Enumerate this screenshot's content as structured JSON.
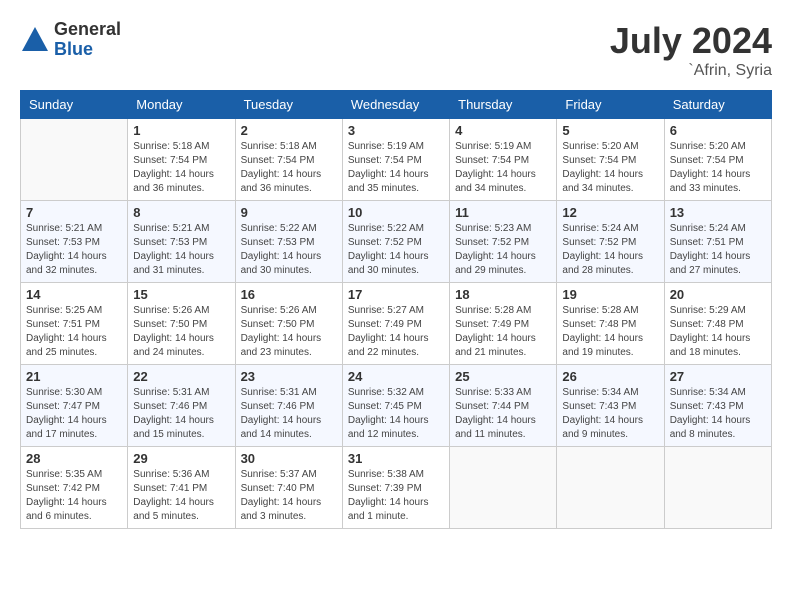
{
  "header": {
    "logo_general": "General",
    "logo_blue": "Blue",
    "month_year": "July 2024",
    "location": "`Afrin, Syria"
  },
  "days_of_week": [
    "Sunday",
    "Monday",
    "Tuesday",
    "Wednesday",
    "Thursday",
    "Friday",
    "Saturday"
  ],
  "weeks": [
    [
      {
        "day": "",
        "info": ""
      },
      {
        "day": "1",
        "info": "Sunrise: 5:18 AM\nSunset: 7:54 PM\nDaylight: 14 hours\nand 36 minutes."
      },
      {
        "day": "2",
        "info": "Sunrise: 5:18 AM\nSunset: 7:54 PM\nDaylight: 14 hours\nand 36 minutes."
      },
      {
        "day": "3",
        "info": "Sunrise: 5:19 AM\nSunset: 7:54 PM\nDaylight: 14 hours\nand 35 minutes."
      },
      {
        "day": "4",
        "info": "Sunrise: 5:19 AM\nSunset: 7:54 PM\nDaylight: 14 hours\nand 34 minutes."
      },
      {
        "day": "5",
        "info": "Sunrise: 5:20 AM\nSunset: 7:54 PM\nDaylight: 14 hours\nand 34 minutes."
      },
      {
        "day": "6",
        "info": "Sunrise: 5:20 AM\nSunset: 7:54 PM\nDaylight: 14 hours\nand 33 minutes."
      }
    ],
    [
      {
        "day": "7",
        "info": "Sunrise: 5:21 AM\nSunset: 7:53 PM\nDaylight: 14 hours\nand 32 minutes."
      },
      {
        "day": "8",
        "info": "Sunrise: 5:21 AM\nSunset: 7:53 PM\nDaylight: 14 hours\nand 31 minutes."
      },
      {
        "day": "9",
        "info": "Sunrise: 5:22 AM\nSunset: 7:53 PM\nDaylight: 14 hours\nand 30 minutes."
      },
      {
        "day": "10",
        "info": "Sunrise: 5:22 AM\nSunset: 7:52 PM\nDaylight: 14 hours\nand 30 minutes."
      },
      {
        "day": "11",
        "info": "Sunrise: 5:23 AM\nSunset: 7:52 PM\nDaylight: 14 hours\nand 29 minutes."
      },
      {
        "day": "12",
        "info": "Sunrise: 5:24 AM\nSunset: 7:52 PM\nDaylight: 14 hours\nand 28 minutes."
      },
      {
        "day": "13",
        "info": "Sunrise: 5:24 AM\nSunset: 7:51 PM\nDaylight: 14 hours\nand 27 minutes."
      }
    ],
    [
      {
        "day": "14",
        "info": "Sunrise: 5:25 AM\nSunset: 7:51 PM\nDaylight: 14 hours\nand 25 minutes."
      },
      {
        "day": "15",
        "info": "Sunrise: 5:26 AM\nSunset: 7:50 PM\nDaylight: 14 hours\nand 24 minutes."
      },
      {
        "day": "16",
        "info": "Sunrise: 5:26 AM\nSunset: 7:50 PM\nDaylight: 14 hours\nand 23 minutes."
      },
      {
        "day": "17",
        "info": "Sunrise: 5:27 AM\nSunset: 7:49 PM\nDaylight: 14 hours\nand 22 minutes."
      },
      {
        "day": "18",
        "info": "Sunrise: 5:28 AM\nSunset: 7:49 PM\nDaylight: 14 hours\nand 21 minutes."
      },
      {
        "day": "19",
        "info": "Sunrise: 5:28 AM\nSunset: 7:48 PM\nDaylight: 14 hours\nand 19 minutes."
      },
      {
        "day": "20",
        "info": "Sunrise: 5:29 AM\nSunset: 7:48 PM\nDaylight: 14 hours\nand 18 minutes."
      }
    ],
    [
      {
        "day": "21",
        "info": "Sunrise: 5:30 AM\nSunset: 7:47 PM\nDaylight: 14 hours\nand 17 minutes."
      },
      {
        "day": "22",
        "info": "Sunrise: 5:31 AM\nSunset: 7:46 PM\nDaylight: 14 hours\nand 15 minutes."
      },
      {
        "day": "23",
        "info": "Sunrise: 5:31 AM\nSunset: 7:46 PM\nDaylight: 14 hours\nand 14 minutes."
      },
      {
        "day": "24",
        "info": "Sunrise: 5:32 AM\nSunset: 7:45 PM\nDaylight: 14 hours\nand 12 minutes."
      },
      {
        "day": "25",
        "info": "Sunrise: 5:33 AM\nSunset: 7:44 PM\nDaylight: 14 hours\nand 11 minutes."
      },
      {
        "day": "26",
        "info": "Sunrise: 5:34 AM\nSunset: 7:43 PM\nDaylight: 14 hours\nand 9 minutes."
      },
      {
        "day": "27",
        "info": "Sunrise: 5:34 AM\nSunset: 7:43 PM\nDaylight: 14 hours\nand 8 minutes."
      }
    ],
    [
      {
        "day": "28",
        "info": "Sunrise: 5:35 AM\nSunset: 7:42 PM\nDaylight: 14 hours\nand 6 minutes."
      },
      {
        "day": "29",
        "info": "Sunrise: 5:36 AM\nSunset: 7:41 PM\nDaylight: 14 hours\nand 5 minutes."
      },
      {
        "day": "30",
        "info": "Sunrise: 5:37 AM\nSunset: 7:40 PM\nDaylight: 14 hours\nand 3 minutes."
      },
      {
        "day": "31",
        "info": "Sunrise: 5:38 AM\nSunset: 7:39 PM\nDaylight: 14 hours\nand 1 minute."
      },
      {
        "day": "",
        "info": ""
      },
      {
        "day": "",
        "info": ""
      },
      {
        "day": "",
        "info": ""
      }
    ]
  ]
}
